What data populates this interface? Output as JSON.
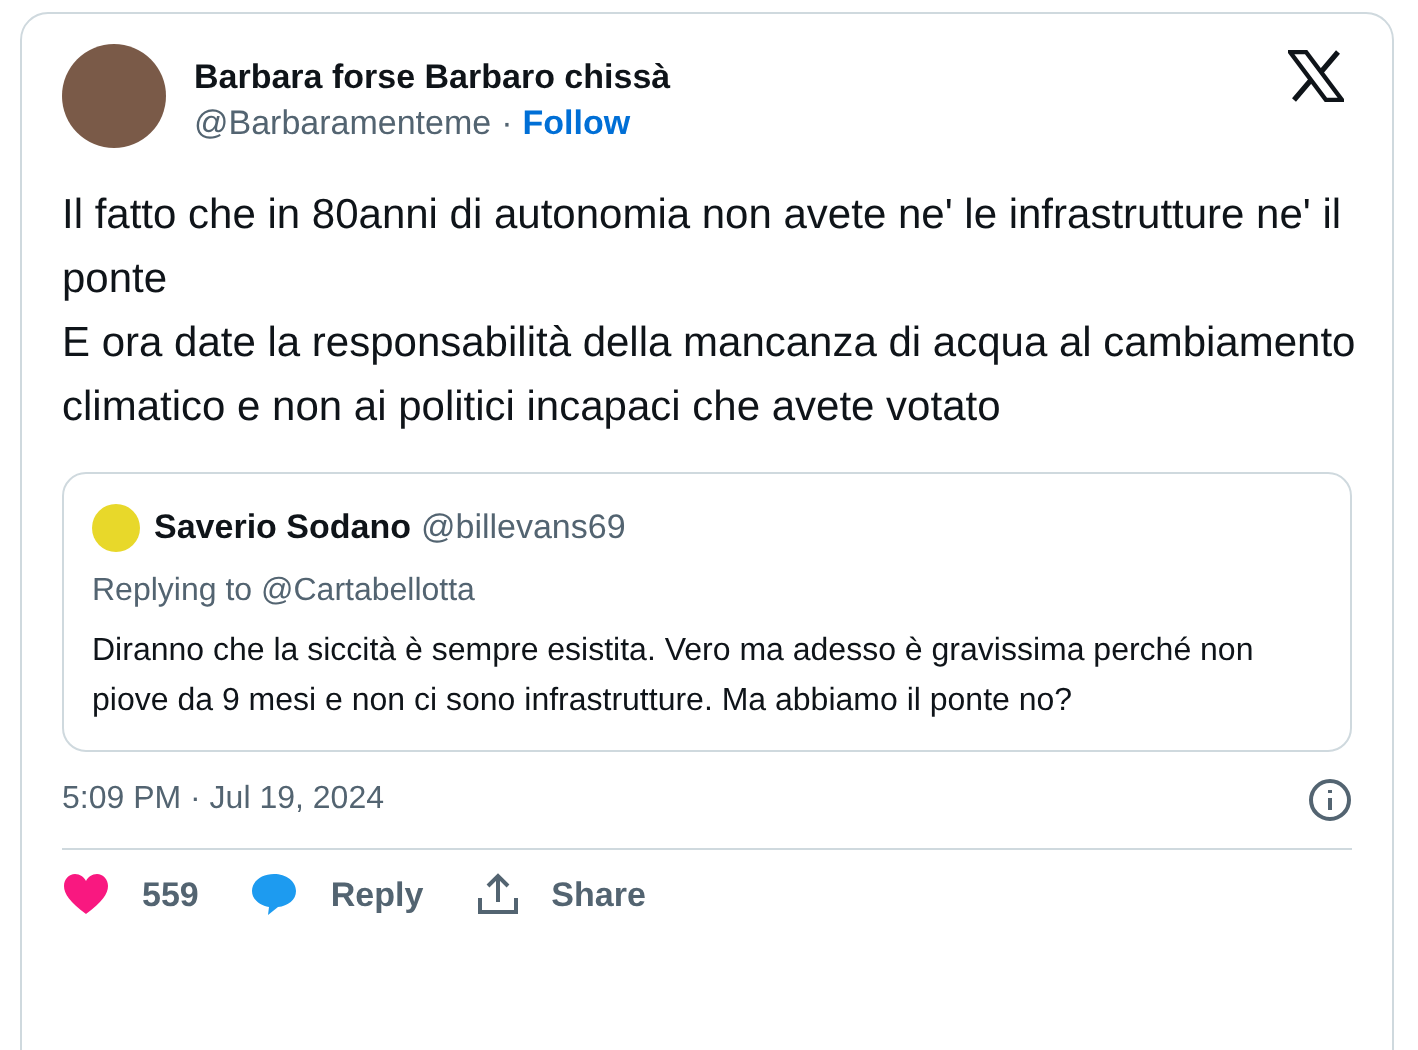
{
  "author": {
    "name": "Barbara forse Barbaro chissà",
    "handle": "@Barbaramenteme",
    "separator": "·",
    "follow": "Follow"
  },
  "body": [
    "Il fatto che in 80anni di autonomia non avete ne' le infrastrutture ne' il ponte",
    "E ora date la responsabilità della mancanza di acqua al cambiamento climatico e non ai politici incapaci che avete votato"
  ],
  "quoted": {
    "name": "Saverio Sodano",
    "handle": "@billevans69",
    "replying": "Replying to @Cartabellotta",
    "text": "Diranno che la siccità è sempre esistita. Vero ma adesso è gravissima perché non piove da 9 mesi e non ci sono infrastrutture. Ma abbiamo il ponte no?"
  },
  "timestamp": "5:09 PM · Jul 19, 2024",
  "actions": [
    {
      "kind": "like",
      "label": "559"
    },
    {
      "kind": "reply",
      "label": "Reply"
    },
    {
      "kind": "share",
      "label": "Share"
    }
  ]
}
